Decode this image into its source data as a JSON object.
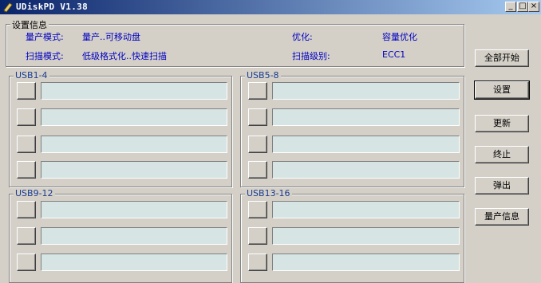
{
  "window": {
    "title": "UDiskPD V1.38",
    "minimize": "_",
    "maximize": "□",
    "close": "×"
  },
  "settings": {
    "legend": "设置信息",
    "mode_label": "量产模式:",
    "mode_value": "量产..可移动盘",
    "optimize_label": "优化:",
    "optimize_value": "容量优化",
    "scan_mode_label": "扫描模式:",
    "scan_mode_value": "低级格式化..快速扫描",
    "scan_level_label": "扫描级别:",
    "scan_level_value": "ECC1"
  },
  "groups": [
    {
      "label": "USB1-4"
    },
    {
      "label": "USB5-8"
    },
    {
      "label": "USB9-12"
    },
    {
      "label": "USB13-16"
    }
  ],
  "actions": {
    "start_all": "全部开始",
    "settings": "设置",
    "update": "更新",
    "stop": "终止",
    "eject": "弹出",
    "mp_info": "量产信息"
  }
}
